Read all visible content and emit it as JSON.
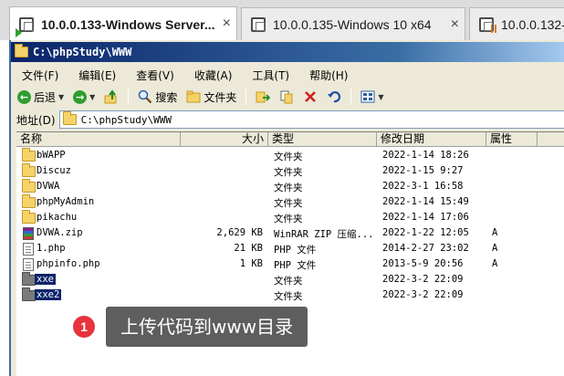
{
  "vm_tabs": [
    {
      "label": "10.0.0.133-Windows Server...",
      "close": "×"
    },
    {
      "label": "10.0.0.135-Windows 10 x64",
      "close": "×"
    },
    {
      "label": "10.0.0.132-k"
    }
  ],
  "window": {
    "title": "C:\\phpStudy\\WWW"
  },
  "menu": [
    "文件(F)",
    "编辑(E)",
    "查看(V)",
    "收藏(A)",
    "工具(T)",
    "帮助(H)"
  ],
  "toolbar": {
    "back": "后退",
    "search": "搜索",
    "folders": "文件夹"
  },
  "address": {
    "label": "地址(D)",
    "value": "C:\\phpStudy\\WWW"
  },
  "columns": {
    "name": "名称",
    "size": "大小",
    "type": "类型",
    "date": "修改日期",
    "attr": "属性"
  },
  "files": [
    {
      "name": "bWAPP",
      "size": "",
      "type": "文件夹",
      "date": "2022-1-14 18:26",
      "attr": ""
    },
    {
      "name": "Discuz",
      "size": "",
      "type": "文件夹",
      "date": "2022-1-15 9:27",
      "attr": ""
    },
    {
      "name": "DVWA",
      "size": "",
      "type": "文件夹",
      "date": "2022-3-1 16:58",
      "attr": ""
    },
    {
      "name": "phpMyAdmin",
      "size": "",
      "type": "文件夹",
      "date": "2022-1-14 15:49",
      "attr": ""
    },
    {
      "name": "pikachu",
      "size": "",
      "type": "文件夹",
      "date": "2022-1-14 17:06",
      "attr": ""
    },
    {
      "name": "DVWA.zip",
      "size": "2,629 KB",
      "type": "WinRAR ZIP 压缩...",
      "date": "2022-1-22 12:05",
      "attr": "A"
    },
    {
      "name": "1.php",
      "size": "21 KB",
      "type": "PHP 文件",
      "date": "2014-2-27 23:02",
      "attr": "A"
    },
    {
      "name": "phpinfo.php",
      "size": "1 KB",
      "type": "PHP 文件",
      "date": "2013-5-9 20:56",
      "attr": "A"
    },
    {
      "name": "xxe",
      "size": "",
      "type": "文件夹",
      "date": "2022-3-2 22:09",
      "attr": ""
    },
    {
      "name": "xxe2",
      "size": "",
      "type": "文件夹",
      "date": "2022-3-2 22:09",
      "attr": ""
    }
  ],
  "annotation": {
    "number": "1",
    "text": "上传代码到www目录",
    "badge_color": "#e6333c"
  },
  "icons": [
    "vm-icon",
    "folder-icon",
    "back-icon",
    "forward-icon",
    "up-icon",
    "search-icon",
    "folders-icon",
    "move-icon",
    "copy-icon",
    "delete-icon",
    "undo-icon",
    "views-icon",
    "zip-icon",
    "file-icon"
  ]
}
